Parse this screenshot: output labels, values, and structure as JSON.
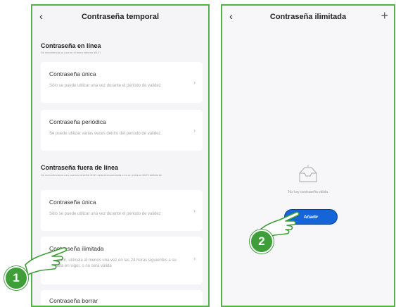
{
  "left_screen": {
    "title": "Contraseña temporal",
    "online_section": {
      "title": "Contraseña en línea",
      "desc": "Se recomienda su uso en el buen entorno Wi-Fi"
    },
    "online_cards": [
      {
        "title": "Contraseña única",
        "desc": "Sólo se puede utilizar una vez durante el periodo de validez"
      },
      {
        "title": "Contraseña periódica",
        "desc": "Se puede utilizar varias veces dentro del periodo de validez"
      }
    ],
    "offline_section": {
      "title": "Contraseña fuera de línea",
      "desc": "Se recomienda su uso cuando la señal Wi-Fi está desconectada o en un entorno Wi-Fi deficiente"
    },
    "offline_cards": [
      {
        "title": "Contraseña única",
        "desc": "Sólo se puede utilizar una vez durante el periodo de validez"
      },
      {
        "title": "Contraseña ilimitada",
        "desc": "Por favor, utilícela al menos una vez en las 24 horas siguientes a su entrada en vigor, o no será válida"
      },
      {
        "title": "Contraseña borrar"
      }
    ]
  },
  "right_screen": {
    "title": "Contraseña ilimitada",
    "empty_text": "No hay contraseña válida",
    "add_button": "Añadir"
  },
  "callouts": {
    "step1": "1",
    "step2": "2"
  },
  "colors": {
    "frame": "#55b04a",
    "badge": "#3f9e3a",
    "button": "#1565d8"
  }
}
